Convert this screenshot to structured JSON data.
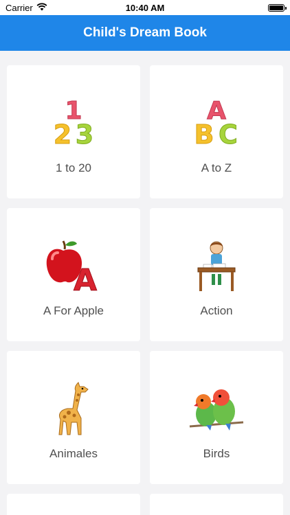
{
  "status": {
    "carrier": "Carrier",
    "time": "10:40 AM"
  },
  "nav": {
    "title": "Child's Dream Book"
  },
  "categories": [
    {
      "label": "1 to 20",
      "icon": "numbers-123-icon"
    },
    {
      "label": "A to Z",
      "icon": "letters-abc-icon"
    },
    {
      "label": "A For Apple",
      "icon": "apple-letter-a-icon"
    },
    {
      "label": "Action",
      "icon": "boy-at-desk-icon"
    },
    {
      "label": "Animales",
      "icon": "giraffe-icon"
    },
    {
      "label": "Birds",
      "icon": "lovebirds-icon"
    }
  ],
  "colors": {
    "nav": "#1f86e8",
    "background": "#f3f3f5",
    "card": "#ffffff",
    "label": "#4f4f4f"
  }
}
